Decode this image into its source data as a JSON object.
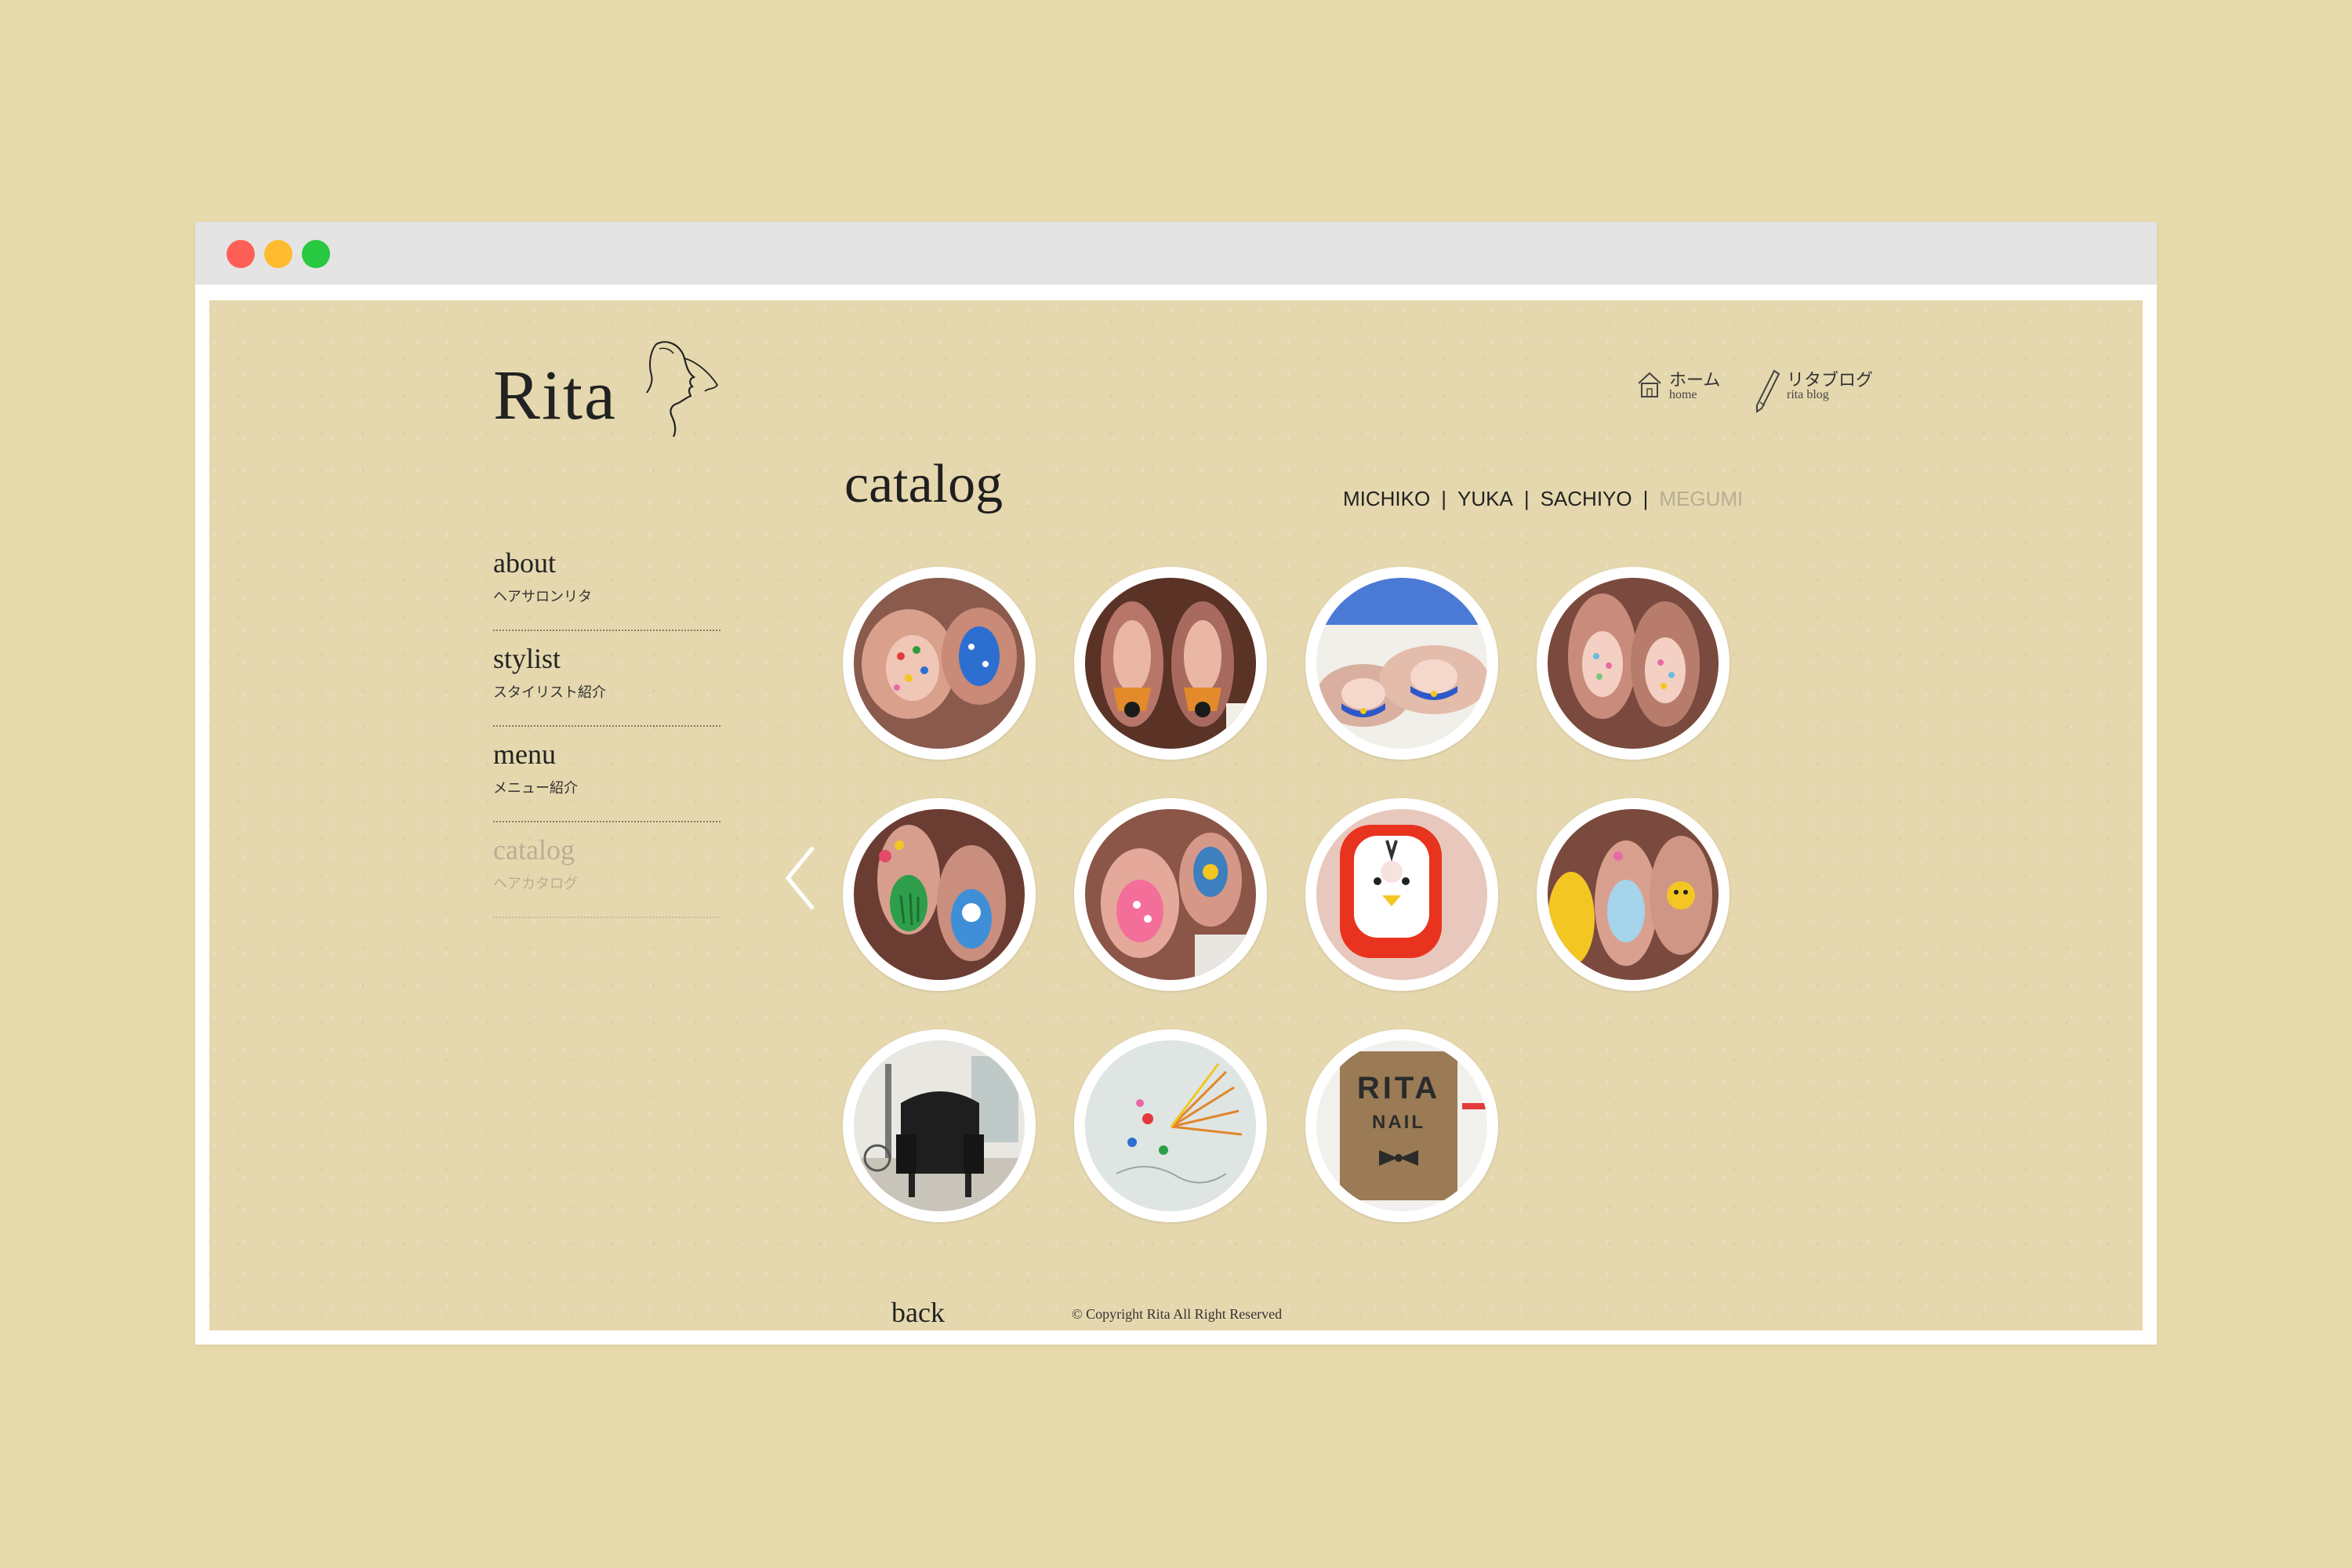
{
  "window": {
    "controls": [
      "close",
      "minimize",
      "maximize"
    ]
  },
  "site": {
    "logo_text": "Rita",
    "top_nav": {
      "home": {
        "jp": "ホーム",
        "en": "home",
        "icon": "house-icon"
      },
      "blog": {
        "jp": "リタブログ",
        "en": "rita blog",
        "icon": "pen-icon"
      }
    }
  },
  "sidebar": {
    "items": [
      {
        "en": "about",
        "jp": "ヘアサロンリタ",
        "active": false
      },
      {
        "en": "stylist",
        "jp": "スタイリスト紹介",
        "active": false
      },
      {
        "en": "menu",
        "jp": "メニュー紹介",
        "active": false
      },
      {
        "en": "catalog",
        "jp": "ヘアカタログ",
        "active": true
      }
    ]
  },
  "catalog": {
    "title": "catalog",
    "stylists": [
      "MICHIKO",
      "YUKA",
      "SACHIYO",
      "MEGUMI"
    ],
    "current_stylist": "MEGUMI",
    "separator": "|",
    "thumbnails": [
      "nail-colorful-dots",
      "nail-orange-black-tips",
      "nail-blue-french",
      "nail-pastel-dots",
      "nail-cactus-green",
      "nail-pink-floral",
      "nail-bear-face",
      "nail-yellow-bear",
      "salon-black-chair",
      "salon-wall-art",
      "rita-nail-sign"
    ],
    "sign_line1": "RITA",
    "sign_line2": "NAIL"
  },
  "footer": {
    "back_label": "back",
    "copyright": "© Copyright Rita All Right Reserved"
  },
  "colors": {
    "desk_background": "#e7dbad",
    "page_background": "#e6d8ae",
    "inactive_text": "#b7ad93",
    "text": "#222222"
  }
}
